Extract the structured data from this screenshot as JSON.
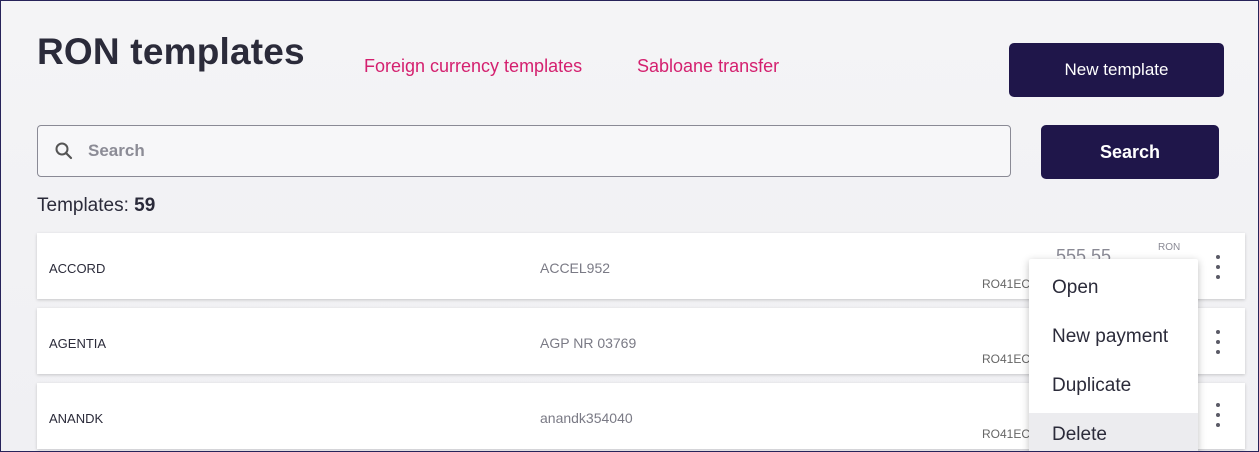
{
  "header": {
    "title": "RON templates",
    "tabs": [
      "Foreign currency templates",
      "Sabloane transfer"
    ],
    "new_button": "New template"
  },
  "search": {
    "placeholder": "Search",
    "button": "Search"
  },
  "count": {
    "label": "Templates:",
    "value": "59"
  },
  "rows": [
    {
      "name": "ACCORD",
      "reference": "ACCEL952",
      "iban": "RO41EC",
      "amount": "555.55",
      "currency": "RON"
    },
    {
      "name": "AGENTIA",
      "reference": "AGP NR 03769",
      "iban": "RO41EC",
      "amount": "",
      "currency": ""
    },
    {
      "name": "ANANDK",
      "reference": "anandk354040",
      "iban": "RO41EC",
      "amount": "",
      "currency": ""
    }
  ],
  "context_menu": {
    "items": [
      "Open",
      "New payment",
      "Duplicate",
      "Delete"
    ]
  },
  "colors": {
    "accent": "#1f164a",
    "link": "#d4206f"
  }
}
